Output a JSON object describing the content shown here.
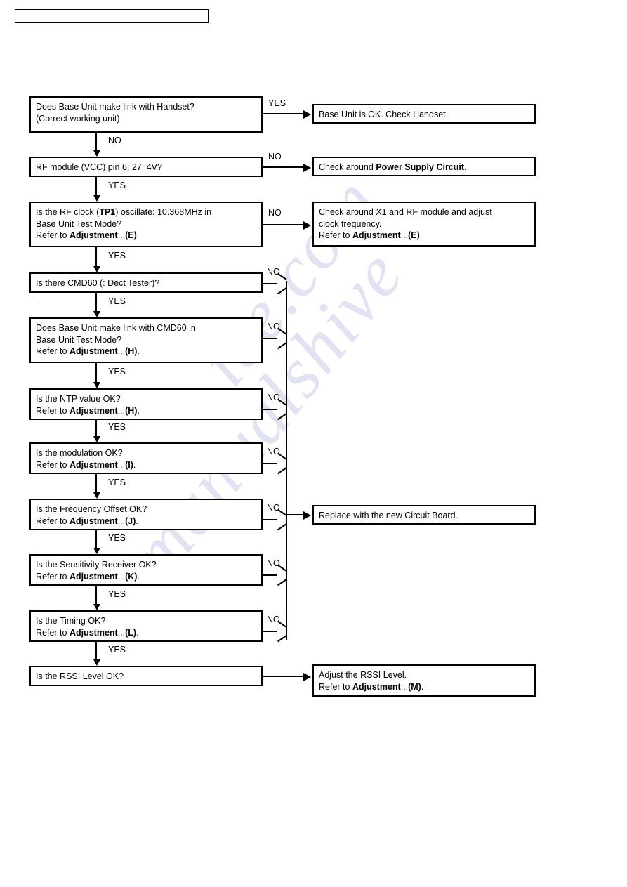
{
  "header": {
    "box_text": ""
  },
  "watermark": {
    "line1": "ice.com",
    "line2": "manualshive"
  },
  "flowchart": {
    "type": "flowchart",
    "title": "Base Unit RF Troubleshooting",
    "left_nodes": [
      {
        "id": "n1",
        "lines": [
          [
            {
              "t": "Does Base Unit make link with Handset?",
              "b": false
            }
          ],
          [
            {
              "t": "(Correct working unit)",
              "b": false
            }
          ]
        ]
      },
      {
        "id": "n2",
        "lines": [
          [
            {
              "t": "RF module (VCC) pin 6, 27: 4V?",
              "b": false
            }
          ]
        ]
      },
      {
        "id": "n3",
        "lines": [
          [
            {
              "t": "Is the RF clock (",
              "b": false
            },
            {
              "t": "TP1",
              "b": true
            },
            {
              "t": ") oscillate: 10.368MHz in",
              "b": false
            }
          ],
          [
            {
              "t": "Base Unit Test Mode?",
              "b": false
            }
          ],
          [
            {
              "t": "Refer to ",
              "b": false
            },
            {
              "t": "Adjustment",
              "b": true
            },
            {
              "t": "...",
              "b": false
            },
            {
              "t": "(E)",
              "b": true
            },
            {
              "t": ".",
              "b": false
            }
          ]
        ]
      },
      {
        "id": "n4",
        "lines": [
          [
            {
              "t": "Is there CMD60 (: Dect Tester)?",
              "b": false
            }
          ]
        ]
      },
      {
        "id": "n5",
        "lines": [
          [
            {
              "t": "Does Base Unit make link with CMD60 in",
              "b": false
            }
          ],
          [
            {
              "t": "Base Unit Test Mode?",
              "b": false
            }
          ],
          [
            {
              "t": "Refer to ",
              "b": false
            },
            {
              "t": "Adjustment",
              "b": true
            },
            {
              "t": "...",
              "b": false
            },
            {
              "t": "(H)",
              "b": true
            },
            {
              "t": ".",
              "b": false
            }
          ]
        ]
      },
      {
        "id": "n6",
        "lines": [
          [
            {
              "t": "Is the NTP value OK?",
              "b": false
            }
          ],
          [
            {
              "t": "Refer to ",
              "b": false
            },
            {
              "t": "Adjustment",
              "b": true
            },
            {
              "t": "...",
              "b": false
            },
            {
              "t": "(H)",
              "b": true
            },
            {
              "t": ".",
              "b": false
            }
          ]
        ]
      },
      {
        "id": "n7",
        "lines": [
          [
            {
              "t": "Is the modulation OK?",
              "b": false
            }
          ],
          [
            {
              "t": "Refer to ",
              "b": false
            },
            {
              "t": "Adjustment",
              "b": true
            },
            {
              "t": "...",
              "b": false
            },
            {
              "t": "(I)",
              "b": true
            },
            {
              "t": ".",
              "b": false
            }
          ]
        ]
      },
      {
        "id": "n8",
        "lines": [
          [
            {
              "t": "Is the Frequency Offset OK?",
              "b": false
            }
          ],
          [
            {
              "t": "Refer to ",
              "b": false
            },
            {
              "t": "Adjustment",
              "b": true
            },
            {
              "t": "...",
              "b": false
            },
            {
              "t": "(J)",
              "b": true
            },
            {
              "t": ".",
              "b": false
            }
          ]
        ]
      },
      {
        "id": "n9",
        "lines": [
          [
            {
              "t": "Is the Sensitivity Receiver OK?",
              "b": false
            }
          ],
          [
            {
              "t": "Refer to ",
              "b": false
            },
            {
              "t": "Adjustment",
              "b": true
            },
            {
              "t": "...",
              "b": false
            },
            {
              "t": "(K)",
              "b": true
            },
            {
              "t": ".",
              "b": false
            }
          ]
        ]
      },
      {
        "id": "n10",
        "lines": [
          [
            {
              "t": "Is the Timing OK?",
              "b": false
            }
          ],
          [
            {
              "t": "Refer to ",
              "b": false
            },
            {
              "t": "Adjustment",
              "b": true
            },
            {
              "t": "...",
              "b": false
            },
            {
              "t": "(L)",
              "b": true
            },
            {
              "t": ".",
              "b": false
            }
          ]
        ]
      },
      {
        "id": "n11",
        "lines": [
          [
            {
              "t": "Is the RSSI Level OK?",
              "b": false
            }
          ]
        ]
      }
    ],
    "right_nodes": [
      {
        "id": "r1",
        "lines": [
          [
            {
              "t": "Base Unit is OK. Check Handset.",
              "b": false
            }
          ]
        ]
      },
      {
        "id": "r2",
        "lines": [
          [
            {
              "t": "Check around ",
              "b": false
            },
            {
              "t": "Power Supply Circuit",
              "b": true
            },
            {
              "t": ".",
              "b": false
            }
          ]
        ]
      },
      {
        "id": "r3",
        "lines": [
          [
            {
              "t": "Check around X1 and RF module and adjust",
              "b": false
            }
          ],
          [
            {
              "t": "clock frequency.",
              "b": false
            }
          ],
          [
            {
              "t": "Refer to ",
              "b": false
            },
            {
              "t": "Adjustment",
              "b": true
            },
            {
              "t": "...",
              "b": false
            },
            {
              "t": "(E)",
              "b": true
            },
            {
              "t": ".",
              "b": false
            }
          ]
        ]
      },
      {
        "id": "r4",
        "lines": [
          [
            {
              "t": "Replace with the new Circuit Board.",
              "b": false
            }
          ]
        ]
      },
      {
        "id": "r5",
        "lines": [
          [
            {
              "t": "Adjust the RSSI Level.",
              "b": false
            }
          ],
          [
            {
              "t": "Refer to ",
              "b": false
            },
            {
              "t": "Adjustment",
              "b": true
            },
            {
              "t": "...",
              "b": false
            },
            {
              "t": "(M)",
              "b": true
            },
            {
              "t": ".",
              "b": false
            }
          ]
        ]
      }
    ],
    "edge_labels": {
      "yes": "YES",
      "no": "NO"
    },
    "edges": [
      {
        "from": "n1",
        "to": "r1",
        "label": "YES"
      },
      {
        "from": "n1",
        "to": "n2",
        "label": "NO"
      },
      {
        "from": "n2",
        "to": "r2",
        "label": "NO"
      },
      {
        "from": "n2",
        "to": "n3",
        "label": "YES"
      },
      {
        "from": "n3",
        "to": "r3",
        "label": "NO"
      },
      {
        "from": "n3",
        "to": "n4",
        "label": "YES"
      },
      {
        "from": "n4",
        "to": "r4",
        "label": "NO"
      },
      {
        "from": "n4",
        "to": "n5",
        "label": "YES"
      },
      {
        "from": "n5",
        "to": "r4",
        "label": "NO"
      },
      {
        "from": "n5",
        "to": "n6",
        "label": "YES"
      },
      {
        "from": "n6",
        "to": "r4",
        "label": "NO"
      },
      {
        "from": "n6",
        "to": "n7",
        "label": "YES"
      },
      {
        "from": "n7",
        "to": "r4",
        "label": "NO"
      },
      {
        "from": "n7",
        "to": "n8",
        "label": "YES"
      },
      {
        "from": "n8",
        "to": "r4",
        "label": "NO"
      },
      {
        "from": "n8",
        "to": "n9",
        "label": "YES"
      },
      {
        "from": "n9",
        "to": "r4",
        "label": "NO"
      },
      {
        "from": "n9",
        "to": "n10",
        "label": "YES"
      },
      {
        "from": "n10",
        "to": "r4",
        "label": "NO"
      },
      {
        "from": "n10",
        "to": "n11",
        "label": "YES"
      },
      {
        "from": "n11",
        "to": "r5",
        "label": ""
      }
    ]
  },
  "colors": {
    "line": "#000000",
    "background": "#ffffff",
    "watermark": "#c9cbe8"
  }
}
